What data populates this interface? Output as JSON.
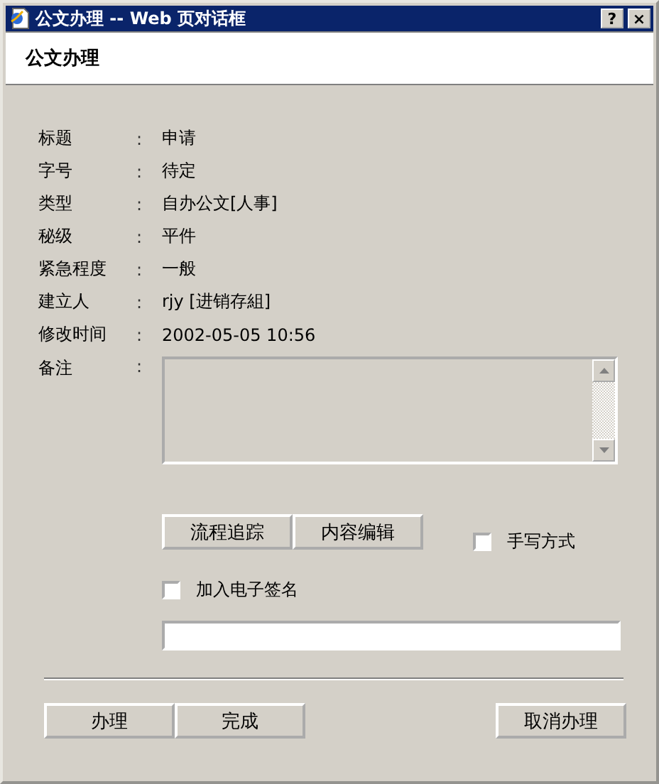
{
  "window": {
    "title": "公文办理 -- Web 页对话框",
    "buttons": [
      "?",
      "×"
    ]
  },
  "header": {
    "title": "公文办理"
  },
  "fields": [
    {
      "label": "标题",
      "colon": ":",
      "value": "申请"
    },
    {
      "label": "字号",
      "colon": ":",
      "value": "待定"
    },
    {
      "label": "类型",
      "colon": ":",
      "value": "自办公文[人事]"
    },
    {
      "label": "秘级",
      "colon": ":",
      "value": "平件"
    },
    {
      "label": "紧急程度",
      "colon": ":",
      "value": "一般"
    },
    {
      "label": "建立人",
      "colon": ":",
      "value": "rjy [进销存組]"
    },
    {
      "label": "修改时间",
      "colon": ":",
      "value": "2002-05-05 10:56"
    }
  ],
  "notes": {
    "label": "备注",
    "colon": ":"
  },
  "action_buttons": [
    "流程追踪",
    "内容编辑"
  ],
  "handwriting": {
    "label": "手写方式",
    "checked": false
  },
  "signature": {
    "label": "加入电子签名",
    "checked": false
  },
  "footer_buttons": [
    {
      "label": "办理",
      "kind": "left"
    },
    {
      "label": "完成",
      "kind": "left"
    },
    {
      "label": "取消办理",
      "kind": "right"
    }
  ]
}
